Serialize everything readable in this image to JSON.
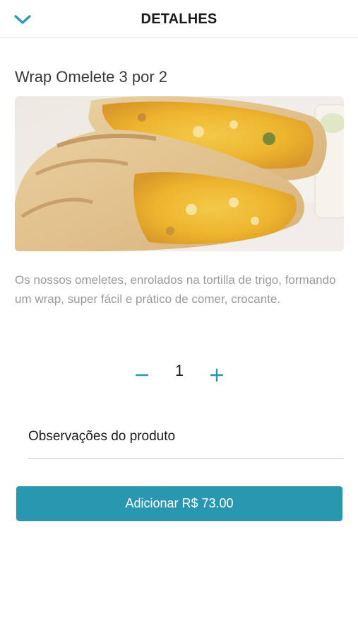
{
  "header": {
    "title": "DETALHES",
    "back_icon": "chevron-down-icon"
  },
  "product": {
    "name": "Wrap Omelete 3 por 2",
    "image_icon": "wrap-omelete-photo",
    "description": "Os nossos omeletes, enrolados na tortilla de trigo, formando um wrap, super fácil e prático de comer, crocante."
  },
  "quantity": {
    "value": "1",
    "minus_icon": "minus-icon",
    "plus_icon": "plus-icon"
  },
  "observations": {
    "label": "Observações do produto"
  },
  "add_button": {
    "label": "Adicionar R$ 73.00"
  },
  "colors": {
    "accent": "#2a97b1",
    "text_muted": "#9a9a9a"
  }
}
